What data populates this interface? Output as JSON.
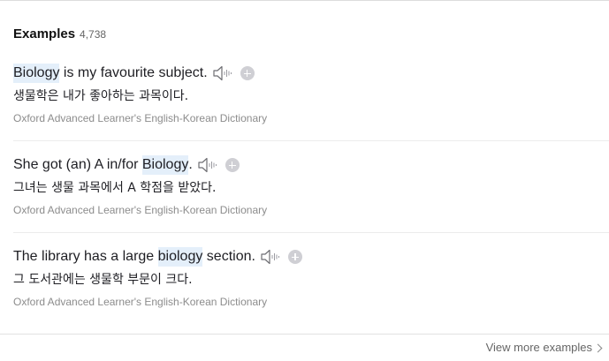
{
  "section": {
    "title": "Examples",
    "count": "4,738"
  },
  "examples": [
    {
      "parts": [
        {
          "text": "Biology",
          "highlight": true
        },
        {
          "text": " is my favourite subject.",
          "highlight": false
        }
      ],
      "translation": "생물학은 내가 좋아하는 과목이다.",
      "source": "Oxford Advanced Learner's English-Korean Dictionary"
    },
    {
      "parts": [
        {
          "text": "She got (an) A in/for ",
          "highlight": false
        },
        {
          "text": "Biology",
          "highlight": true
        },
        {
          "text": ".",
          "highlight": false
        }
      ],
      "translation": "그녀는 생물 과목에서 A 학점을 받았다.",
      "source": "Oxford Advanced Learner's English-Korean Dictionary"
    },
    {
      "parts": [
        {
          "text": "The library has a large ",
          "highlight": false
        },
        {
          "text": "biology",
          "highlight": true
        },
        {
          "text": " section.",
          "highlight": false
        }
      ],
      "translation": "그 도서관에는 생물학 부문이 크다.",
      "source": "Oxford Advanced Learner's English-Korean Dictionary"
    }
  ],
  "icons": {
    "audio": "speaker-icon",
    "add": "plus-circle-icon"
  },
  "view_more": {
    "label": "View more examples"
  },
  "colors": {
    "highlight": "#e4effa",
    "source_text": "#8c8c8c",
    "plus_circle": "#cfcfd4"
  }
}
